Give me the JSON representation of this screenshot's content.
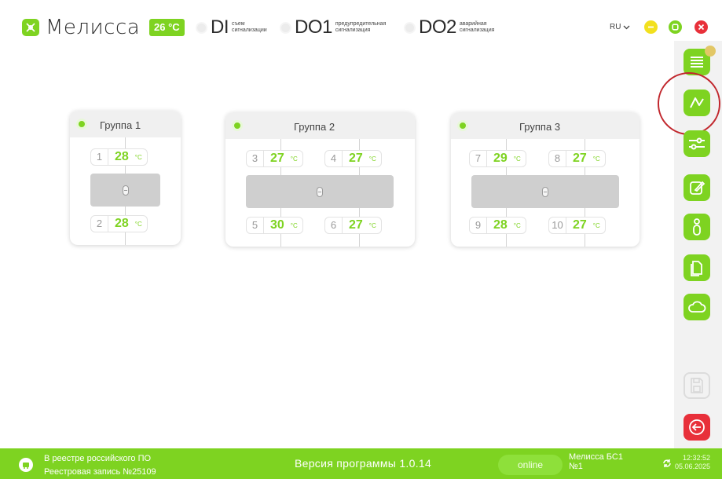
{
  "header": {
    "app_name": "Мелисса",
    "temperature": "26 °C",
    "indicators": [
      {
        "code": "DI",
        "desc": "съем сигнализации"
      },
      {
        "code": "DO1",
        "desc": "предупредительная сигнализация"
      },
      {
        "code": "DO2",
        "desc": "аварийная сигнализация"
      }
    ],
    "language": "RU",
    "colors": {
      "accent": "#7ed321",
      "minimize": "#f2e01e",
      "close": "#e8303a"
    }
  },
  "groups": [
    {
      "title": "Группа 1",
      "sensors": [
        {
          "num": "1",
          "value": "28",
          "unit": "°C"
        },
        {
          "num": "2",
          "value": "28",
          "unit": "°C"
        }
      ]
    },
    {
      "title": "Группа 2",
      "sensors": [
        {
          "num": "3",
          "value": "27",
          "unit": "°C"
        },
        {
          "num": "4",
          "value": "27",
          "unit": "°C"
        },
        {
          "num": "5",
          "value": "30",
          "unit": "°C"
        },
        {
          "num": "6",
          "value": "27",
          "unit": "°C"
        }
      ]
    },
    {
      "title": "Группа 3",
      "sensors": [
        {
          "num": "7",
          "value": "29",
          "unit": "°C"
        },
        {
          "num": "8",
          "value": "27",
          "unit": "°C"
        },
        {
          "num": "9",
          "value": "28",
          "unit": "°C"
        },
        {
          "num": "10",
          "value": "27",
          "unit": "°C"
        }
      ]
    }
  ],
  "sidebar": {
    "icons": [
      "list-icon",
      "chart-icon",
      "sliders-icon",
      "edit-icon",
      "sensor-icon",
      "documents-icon",
      "cloud-icon",
      "save-icon",
      "exit-icon"
    ]
  },
  "footer": {
    "registry_line1": "В реестре российского ПО",
    "registry_line2": "Реестровая запись №25109",
    "version": "Версия программы 1.0.14",
    "status": "online",
    "device_line1": "Мелисса БС1",
    "device_line2": "№1",
    "time": "12:32:52",
    "date": "05.06.2025"
  }
}
